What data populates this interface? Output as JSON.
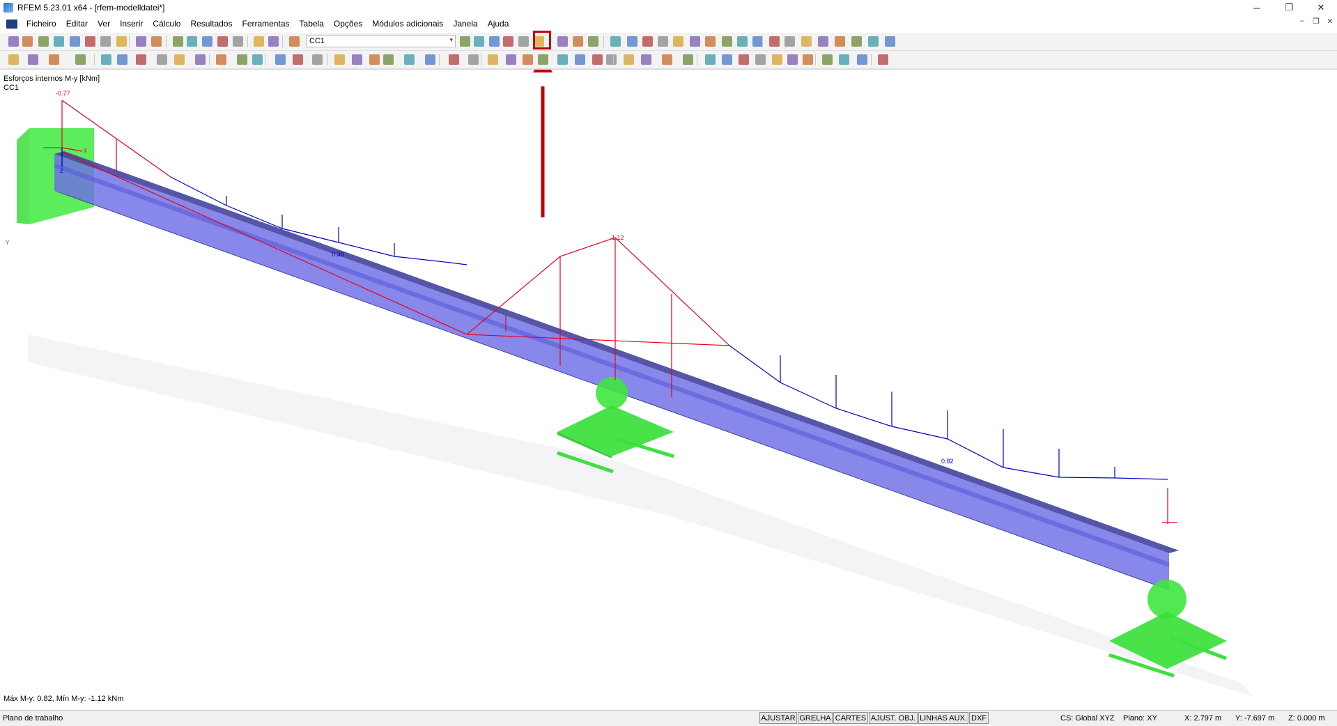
{
  "window": {
    "title": "RFEM 5.23.01 x64 - [rfem-modelldatei*]",
    "controls": [
      "─",
      "❐",
      "✕"
    ]
  },
  "menu": {
    "items": [
      "Ficheiro",
      "Editar",
      "Ver",
      "Inserir",
      "Cálculo",
      "Resultados",
      "Ferramentas",
      "Tabela",
      "Opções",
      "Módulos adicionais",
      "Janela",
      "Ajuda"
    ],
    "mdi_controls": [
      "–",
      "❐",
      "✕"
    ]
  },
  "toolbar": {
    "load_case_value": "CC1",
    "dropdown_glyph": "▾"
  },
  "viewport": {
    "result_title": "Esforços internos M-y [kNm]",
    "load_case": "CC1",
    "summary": "Máx M-y: 0.82, Mín M-y: -1.12 kNm",
    "values": {
      "v1": "-0.77",
      "v2": "-1.12",
      "v3": "0.38",
      "v4": "0.82"
    },
    "axes": {
      "x": "X",
      "y": "Y",
      "z": "Z"
    },
    "colors": {
      "beam": "#6f6fe0",
      "negative_moment": "#e8001c",
      "positive_moment": "#0000c8",
      "support": "#2ee82e",
      "highlight": "#c00000",
      "arrow": "#c00000"
    }
  },
  "statusbar": {
    "left_text": "Plano de trabalho",
    "buttons": [
      "AJUSTAR",
      "GRELHA",
      "CARTES",
      "AJUST. OBJ.",
      "LINHAS AUX.",
      "DXF"
    ],
    "cs": "CS: Global XYZ",
    "plane": "Plano: XY",
    "x": "X:  2.797 m",
    "y": "Y:  -7.697 m",
    "z": "Z:  0.000 m"
  }
}
